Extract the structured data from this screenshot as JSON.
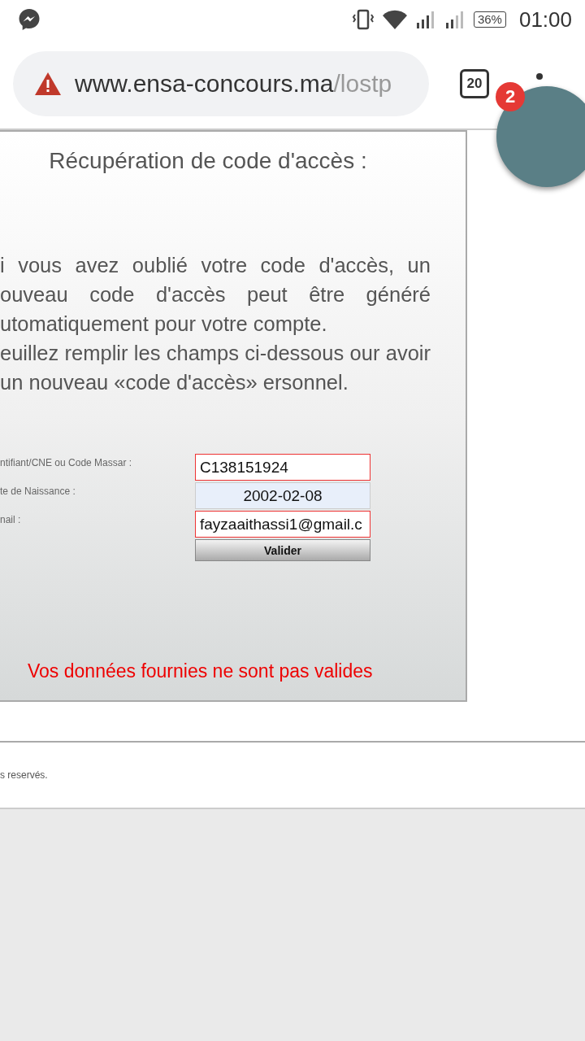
{
  "status_bar": {
    "battery": "36%",
    "time": "01:00"
  },
  "browser": {
    "url_host": "www.ensa-concours.ma",
    "url_path": "/lostp",
    "tab_count": "20"
  },
  "chat_head": {
    "badge": "2"
  },
  "panel": {
    "title": "Récupération de code d'accès :",
    "paragraphs": [
      "i vous avez oublié votre code d'accès, un ouveau code d'accès peut être généré utomatiquement pour votre compte.",
      "euillez remplir les champs ci-dessous our avoir un nouveau «code d'accès» ersonnel."
    ],
    "fields": [
      {
        "label": "ntifiant/CNE ou Code Massar :",
        "value": "C138151924",
        "invalid": true,
        "autofilled": false
      },
      {
        "label": "te de Naissance :",
        "value": "2002-02-08",
        "invalid": false,
        "autofilled": true
      },
      {
        "label": "nail :",
        "value": "fayzaaithassi1@gmail.c",
        "invalid": true,
        "autofilled": false
      }
    ],
    "submit": "Valider",
    "error": "Vos données fournies ne sont pas valides"
  },
  "footer": {
    "text": "s reservés."
  }
}
